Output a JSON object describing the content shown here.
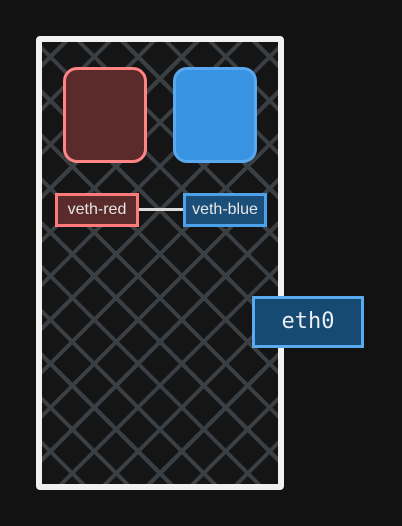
{
  "diagram": {
    "interfaces": {
      "veth_red_label": "veth-red",
      "veth_blue_label": "veth-blue",
      "eth0_label": "eth0"
    },
    "colors": {
      "background": "#121212",
      "host_border": "#f1f1f1",
      "grid_lines": "#3a3f44",
      "red_namespace_fill": "#5b2b2b",
      "red_namespace_border": "#ff8585",
      "blue_namespace_fill": "#3993e3",
      "blue_namespace_border": "#5aa8ee",
      "veth_link": "#dcdcdc",
      "eth0_fill": "#174a72",
      "eth0_border": "#5aaaf0"
    }
  }
}
